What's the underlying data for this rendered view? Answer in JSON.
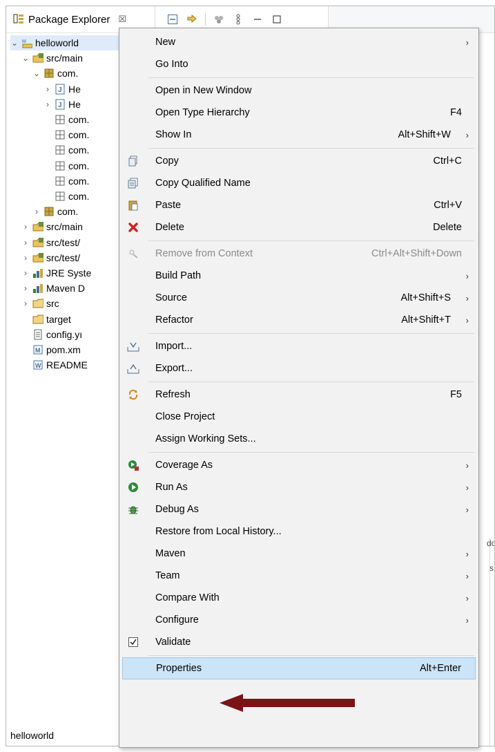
{
  "explorer": {
    "tab_title": "Package Explorer",
    "close_glyph": "☒",
    "toolbar_icons": [
      "collapse-all-icon",
      "link-with-editor-icon",
      "filter-icon",
      "view-menu-icon",
      "minimize-icon",
      "maximize-icon"
    ],
    "tree": [
      {
        "label": "helloworld",
        "icon": "maven-project-icon",
        "arrow": "expanded"
      },
      {
        "label": "src/main",
        "icon": "source-folder-icon",
        "arrow": "expanded"
      },
      {
        "label": "com.",
        "icon": "package-icon",
        "arrow": "expanded"
      },
      {
        "label": "He",
        "icon": "java-file-icon",
        "arrow": "collapsed"
      },
      {
        "label": "He",
        "icon": "java-file-icon",
        "arrow": "collapsed"
      },
      {
        "label": "com.",
        "icon": "empty-package-icon",
        "arrow": "none"
      },
      {
        "label": "com.",
        "icon": "empty-package-icon",
        "arrow": "none"
      },
      {
        "label": "com.",
        "icon": "empty-package-icon",
        "arrow": "none"
      },
      {
        "label": "com.",
        "icon": "empty-package-icon",
        "arrow": "none"
      },
      {
        "label": "com.",
        "icon": "empty-package-icon",
        "arrow": "none"
      },
      {
        "label": "com.",
        "icon": "empty-package-icon",
        "arrow": "none"
      },
      {
        "label": "com.",
        "icon": "package-icon",
        "arrow": "collapsed"
      },
      {
        "label": "src/main",
        "icon": "source-folder-icon",
        "arrow": "collapsed"
      },
      {
        "label": "src/test/",
        "icon": "source-folder-icon",
        "arrow": "collapsed"
      },
      {
        "label": "src/test/",
        "icon": "source-folder-icon",
        "arrow": "collapsed"
      },
      {
        "label": "JRE Syste",
        "icon": "library-icon",
        "arrow": "collapsed"
      },
      {
        "label": "Maven D",
        "icon": "library-icon",
        "arrow": "collapsed"
      },
      {
        "label": "src",
        "icon": "folder-icon",
        "arrow": "collapsed"
      },
      {
        "label": "target",
        "icon": "folder-icon",
        "arrow": "none"
      },
      {
        "label": "config.yı",
        "icon": "file-icon",
        "arrow": "none"
      },
      {
        "label": "pom.xm",
        "icon": "maven-pom-icon",
        "arrow": "none"
      },
      {
        "label": "README",
        "icon": "markdown-file-icon",
        "arrow": "none"
      }
    ],
    "status_text": "helloworld"
  },
  "side_panel": {
    "text1": "do",
    "text2": "s"
  },
  "menu": {
    "items": [
      {
        "label": "New",
        "shortcut": "",
        "submenu": true,
        "icon": ""
      },
      {
        "label": "Go Into",
        "shortcut": "",
        "submenu": false,
        "icon": ""
      },
      {
        "sep": true
      },
      {
        "label": "Open in New Window",
        "shortcut": "",
        "submenu": false,
        "icon": ""
      },
      {
        "label": "Open Type Hierarchy",
        "shortcut": "F4",
        "submenu": false,
        "icon": ""
      },
      {
        "label": "Show In",
        "shortcut": "Alt+Shift+W",
        "submenu": true,
        "icon": ""
      },
      {
        "sep": true
      },
      {
        "label": "Copy",
        "shortcut": "Ctrl+C",
        "submenu": false,
        "icon": "copy-icon"
      },
      {
        "label": "Copy Qualified Name",
        "shortcut": "",
        "submenu": false,
        "icon": "copy-qualified-name-icon"
      },
      {
        "label": "Paste",
        "shortcut": "Ctrl+V",
        "submenu": false,
        "icon": "paste-icon"
      },
      {
        "label": "Delete",
        "shortcut": "Delete",
        "submenu": false,
        "icon": "delete-icon"
      },
      {
        "sep": true
      },
      {
        "label": "Remove from Context",
        "shortcut": "Ctrl+Alt+Shift+Down",
        "submenu": false,
        "icon": "remove-context-icon",
        "disabled": true
      },
      {
        "label": "Build Path",
        "shortcut": "",
        "submenu": true,
        "icon": ""
      },
      {
        "label": "Source",
        "shortcut": "Alt+Shift+S",
        "submenu": true,
        "icon": ""
      },
      {
        "label": "Refactor",
        "shortcut": "Alt+Shift+T",
        "submenu": true,
        "icon": ""
      },
      {
        "sep": true
      },
      {
        "label": "Import...",
        "shortcut": "",
        "submenu": false,
        "icon": "import-icon"
      },
      {
        "label": "Export...",
        "shortcut": "",
        "submenu": false,
        "icon": "export-icon"
      },
      {
        "sep": true
      },
      {
        "label": "Refresh",
        "shortcut": "F5",
        "submenu": false,
        "icon": "refresh-icon"
      },
      {
        "label": "Close Project",
        "shortcut": "",
        "submenu": false,
        "icon": ""
      },
      {
        "label": "Assign Working Sets...",
        "shortcut": "",
        "submenu": false,
        "icon": ""
      },
      {
        "sep": true
      },
      {
        "label": "Coverage As",
        "shortcut": "",
        "submenu": true,
        "icon": "coverage-icon"
      },
      {
        "label": "Run As",
        "shortcut": "",
        "submenu": true,
        "icon": "run-icon"
      },
      {
        "label": "Debug As",
        "shortcut": "",
        "submenu": true,
        "icon": "debug-icon"
      },
      {
        "label": "Restore from Local History...",
        "shortcut": "",
        "submenu": false,
        "icon": ""
      },
      {
        "label": "Maven",
        "shortcut": "",
        "submenu": true,
        "icon": ""
      },
      {
        "label": "Team",
        "shortcut": "",
        "submenu": true,
        "icon": ""
      },
      {
        "label": "Compare With",
        "shortcut": "",
        "submenu": true,
        "icon": ""
      },
      {
        "label": "Configure",
        "shortcut": "",
        "submenu": true,
        "icon": ""
      },
      {
        "label": "Validate",
        "shortcut": "",
        "submenu": false,
        "icon": "checkbox-checked-icon"
      },
      {
        "sep": true
      },
      {
        "label": "Properties",
        "shortcut": "Alt+Enter",
        "submenu": false,
        "icon": "",
        "highlighted": true
      }
    ],
    "submenu_glyph": "›",
    "callout_color": "#7a1416"
  }
}
